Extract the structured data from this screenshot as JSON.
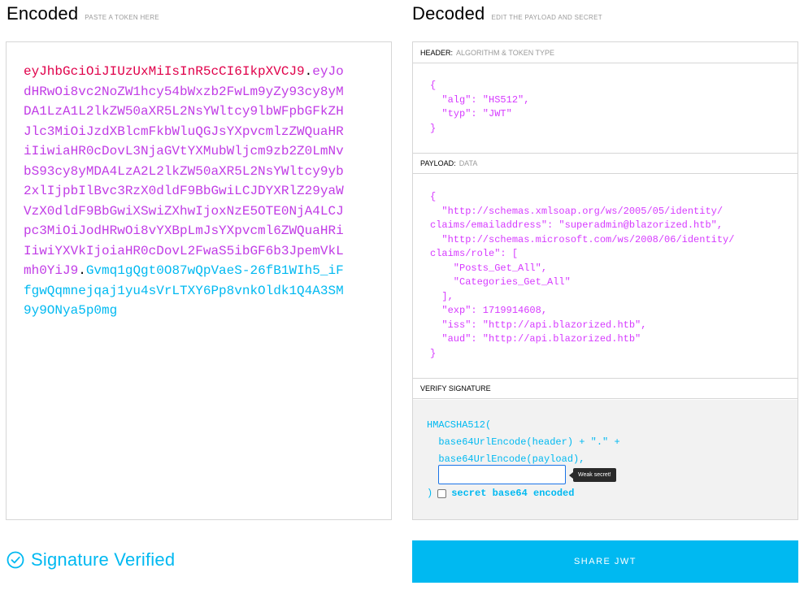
{
  "encoded": {
    "title": "Encoded",
    "subtitle": "PASTE A TOKEN HERE",
    "token": {
      "header": "eyJhbGciOiJIUzUxMiIsInR5cCI6IkpXVCJ9",
      "payload": "eyJodHRwOi8vc2NoZW1hcy54bWxzb2FwLm9yZy93cy8yMDA1LzA1L2lkZW50aXR5L2NsYWltcy9lbWFpbGFkZHJlc3MiOiJzdXBlcmFkbWluQGJsYXpvcmlzZWQuaHRiIiwiaHR0cDovL3NjaGVtYXMubWljcm9zb2Z0LmNvbS93cy8yMDA4LzA2L2lkZW50aXR5L2NsYWltcy9yb2xlIjpbIlBvc3RzX0dldF9BbGwiLCJDYXRlZ29yaWVzX0dldF9BbGwiXSwiZXhwIjoxNzE5OTE0NjA4LCJpc3MiOiJodHRwOi8vYXBpLmJsYXpvcml6ZWQuaHRiIiwiYXVkIjoiaHR0cDovL2FwaS5ibGF6b3JpemVkLmh0YiJ9",
      "signature": "Gvmq1gQgt0O87wQpVaeS-26fB1WIh5_iFfgwQqmnejqaj1yu4sVrLTXY6Pp8vnkOldk1Q4A3SM9y9ONya5p0mg",
      "dot": "."
    }
  },
  "decoded": {
    "title": "Decoded",
    "subtitle": "EDIT THE PAYLOAD AND SECRET",
    "header_section": {
      "label": "HEADER:",
      "sub": "ALGORITHM & TOKEN TYPE"
    },
    "header_json": "{\n  \"alg\": \"HS512\",\n  \"typ\": \"JWT\"\n}",
    "payload_section": {
      "label": "PAYLOAD:",
      "sub": "DATA"
    },
    "payload_json": "{\n  \"http://schemas.xmlsoap.org/ws/2005/05/identity/\nclaims/emailaddress\": \"superadmin@blazorized.htb\",\n  \"http://schemas.microsoft.com/ws/2008/06/identity/\nclaims/role\": [\n    \"Posts_Get_All\",\n    \"Categories_Get_All\"\n  ],\n  \"exp\": 1719914608,\n  \"iss\": \"http://api.blazorized.htb\",\n  \"aud\": \"http://api.blazorized.htb\"\n}",
    "verify_section": {
      "label": "VERIFY SIGNATURE"
    },
    "verify_code": "HMACSHA512(\n  base64UrlEncode(header) + \".\" +\n  base64UrlEncode(payload),",
    "secret_value": "",
    "weak_secret": "Weak secret!",
    "close_paren": ")",
    "base64_label": "secret base64 encoded"
  },
  "status": {
    "text": "Signature Verified"
  },
  "share": {
    "label": "SHARE JWT"
  },
  "colors": {
    "header": "#e0004a",
    "payload": "#c13ce6",
    "signature": "#00b9f1",
    "accent": "#00b9f1"
  }
}
